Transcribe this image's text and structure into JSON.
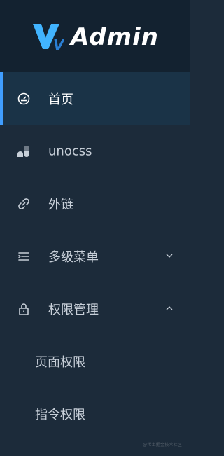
{
  "app": {
    "logo_mark": "V3",
    "title": "Admin"
  },
  "menu": {
    "items": [
      {
        "label": "首页",
        "icon": "dashboard-icon",
        "active": true
      },
      {
        "label": "unocss",
        "icon": "unocss-icon"
      },
      {
        "label": "外链",
        "icon": "link-icon"
      },
      {
        "label": "多级菜单",
        "icon": "menu-icon",
        "chevron": "down"
      },
      {
        "label": "权限管理",
        "icon": "lock-icon",
        "chevron": "up"
      }
    ],
    "sub_items": [
      {
        "label": "页面权限"
      },
      {
        "label": "指令权限"
      }
    ]
  },
  "watermark": "@稀土掘金技术社区",
  "colors": {
    "accent": "#409eff",
    "sidebar_bg": "#1c2b3a",
    "logo_bg": "#132230",
    "active_bg": "#1a3347",
    "text": "#c7cfd8",
    "text_active": "#ffffff"
  }
}
